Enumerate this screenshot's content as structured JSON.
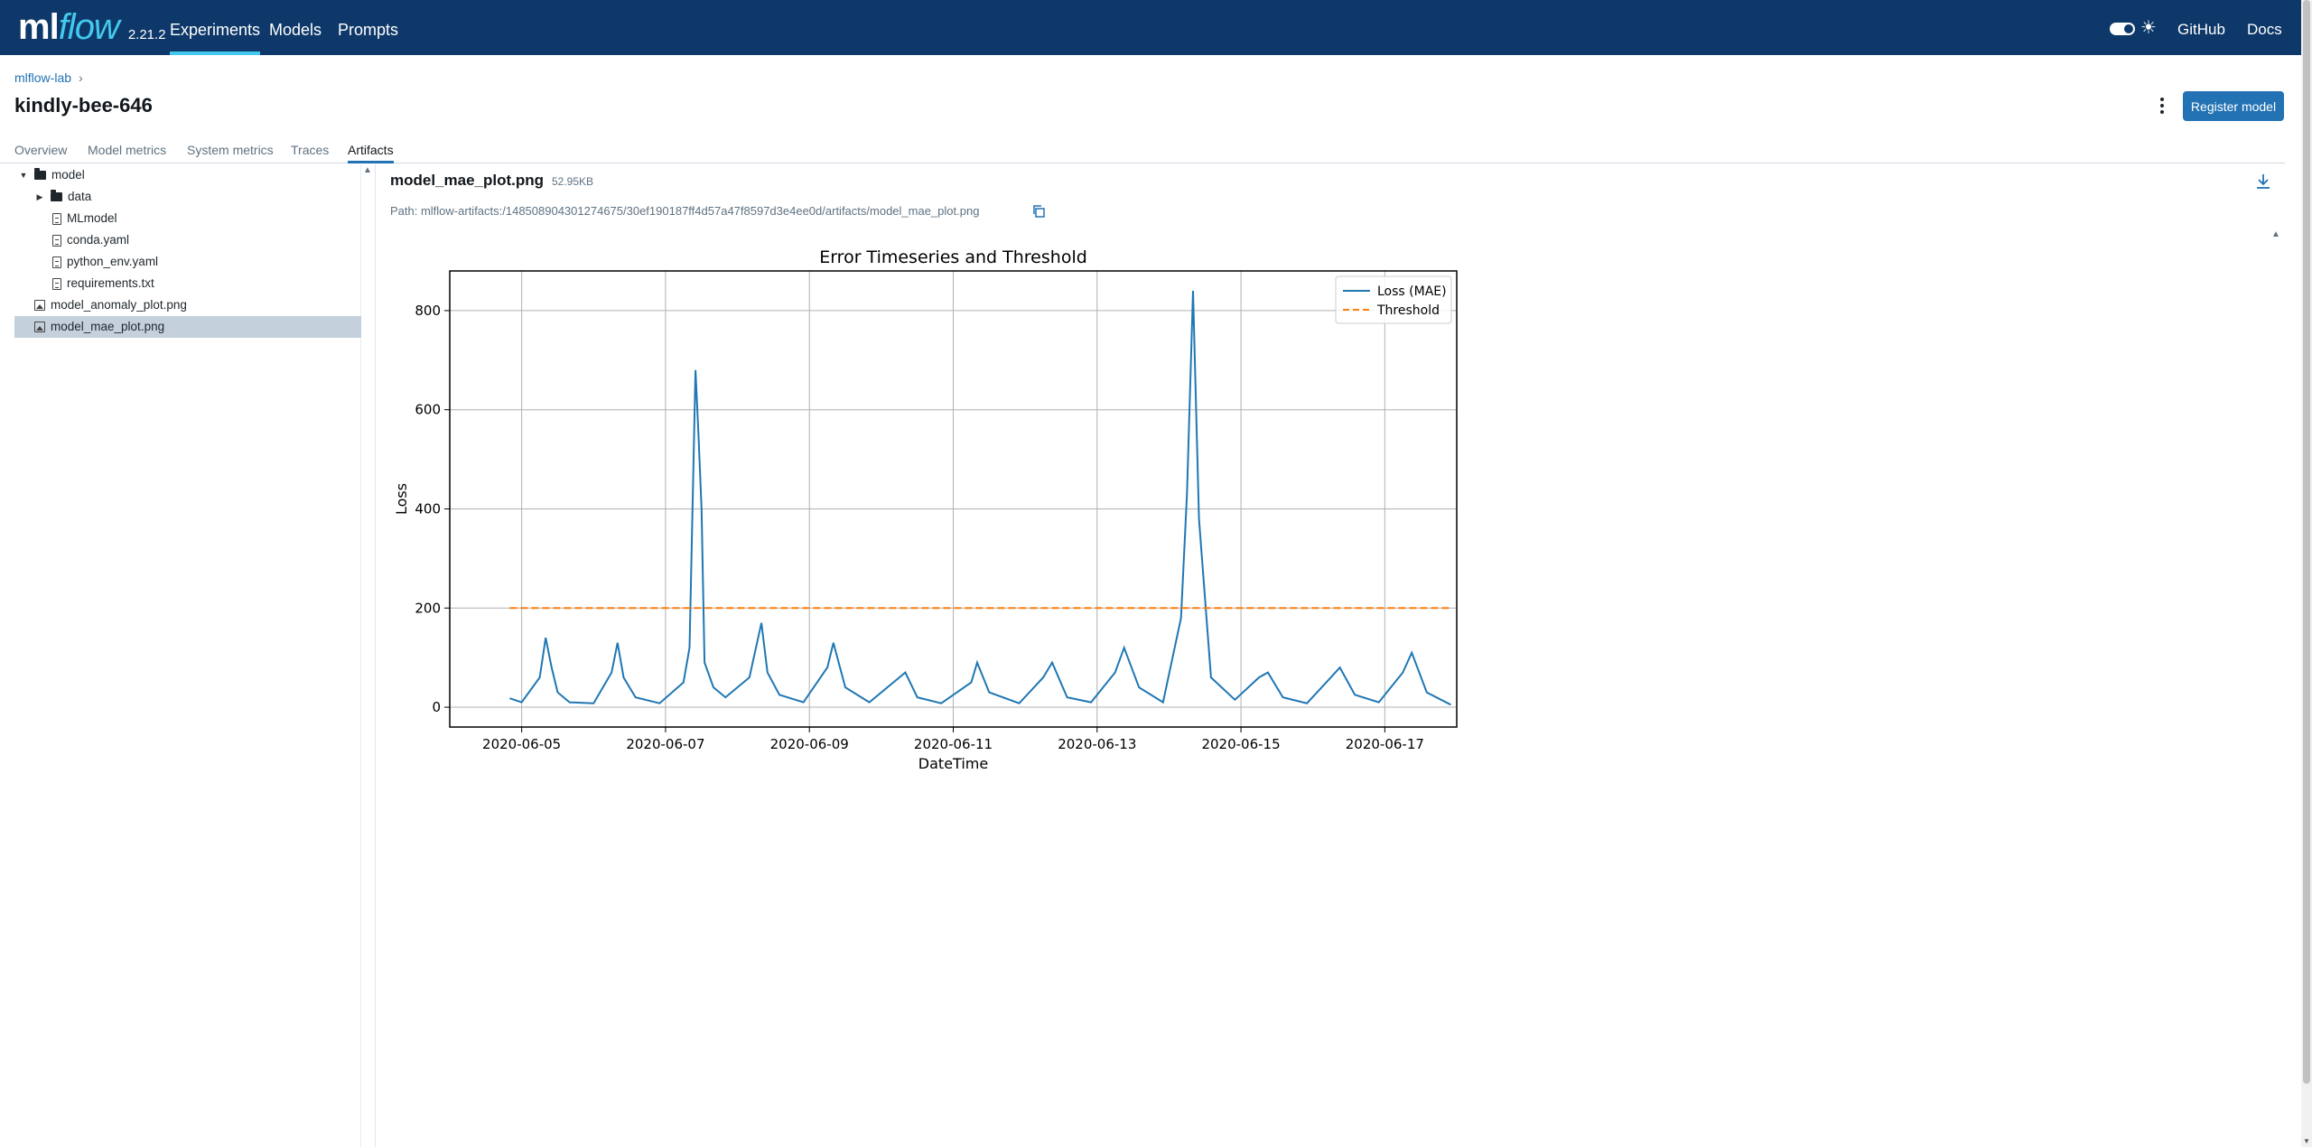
{
  "nav": {
    "logo_ml": "ml",
    "logo_flow": "flow",
    "version": "2.21.2",
    "links": [
      "Experiments",
      "Models",
      "Prompts"
    ],
    "github": "GitHub",
    "docs": "Docs",
    "accent_color": "#43c9ed",
    "bg_color": "#0e3869"
  },
  "header": {
    "breadcrumb": "mlflow-lab",
    "title": "kindly-bee-646",
    "register_button": "Register model"
  },
  "tabs": [
    "Overview",
    "Model metrics",
    "System metrics",
    "Traces",
    "Artifacts"
  ],
  "active_tab": "Artifacts",
  "tree": [
    {
      "label": "model",
      "type": "folder",
      "expanded": true
    },
    {
      "label": "data",
      "type": "folder",
      "expanded": false
    },
    {
      "label": "MLmodel",
      "type": "file"
    },
    {
      "label": "conda.yaml",
      "type": "file"
    },
    {
      "label": "python_env.yaml",
      "type": "file"
    },
    {
      "label": "requirements.txt",
      "type": "file"
    },
    {
      "label": "model_anomaly_plot.png",
      "type": "image"
    },
    {
      "label": "model_mae_plot.png",
      "type": "image",
      "selected": true
    }
  ],
  "artifact": {
    "name": "model_mae_plot.png",
    "size": "52.95KB",
    "path": "Path: mlflow-artifacts:/148508904301274675/30ef190187ff4d57a47f8597d3e4ee0d/artifacts/model_mae_plot.png"
  },
  "chart_data": {
    "type": "line",
    "title": "Error Timeseries and Threshold",
    "xlabel": "DateTime",
    "ylabel": "Loss",
    "xticks": [
      "2020-06-05",
      "2020-06-07",
      "2020-06-09",
      "2020-06-11",
      "2020-06-13",
      "2020-06-15",
      "2020-06-17"
    ],
    "yticks": [
      0,
      200,
      400,
      600,
      800
    ],
    "xlim": [
      "2020-06-04",
      "2020-06-18"
    ],
    "ylim": [
      -40,
      880
    ],
    "grid": true,
    "legend_position": "top-right",
    "series": [
      {
        "name": "Loss (MAE)",
        "color": "#1f77b4",
        "style": "solid",
        "x": [
          "2020-06-04T20:00",
          "2020-06-05T00:00",
          "2020-06-05T06:00",
          "2020-06-05T08:00",
          "2020-06-05T10:00",
          "2020-06-05T12:00",
          "2020-06-05T16:00",
          "2020-06-06T00:00",
          "2020-06-06T06:00",
          "2020-06-06T08:00",
          "2020-06-06T10:00",
          "2020-06-06T14:00",
          "2020-06-06T22:00",
          "2020-06-07T06:00",
          "2020-06-07T08:00",
          "2020-06-07T10:00",
          "2020-06-07T11:00",
          "2020-06-07T12:00",
          "2020-06-07T13:00",
          "2020-06-07T16:00",
          "2020-06-07T20:00",
          "2020-06-08T04:00",
          "2020-06-08T08:00",
          "2020-06-08T10:00",
          "2020-06-08T14:00",
          "2020-06-08T22:00",
          "2020-06-09T06:00",
          "2020-06-09T08:00",
          "2020-06-09T12:00",
          "2020-06-09T20:00",
          "2020-06-10T06:00",
          "2020-06-10T08:00",
          "2020-06-10T12:00",
          "2020-06-10T20:00",
          "2020-06-11T06:00",
          "2020-06-11T08:00",
          "2020-06-11T12:00",
          "2020-06-11T22:00",
          "2020-06-12T06:00",
          "2020-06-12T09:00",
          "2020-06-12T14:00",
          "2020-06-12T22:00",
          "2020-06-13T06:00",
          "2020-06-13T09:00",
          "2020-06-13T14:00",
          "2020-06-13T22:00",
          "2020-06-14T04:00",
          "2020-06-14T06:00",
          "2020-06-14T08:00",
          "2020-06-14T10:00",
          "2020-06-14T14:00",
          "2020-06-14T22:00",
          "2020-06-15T06:00",
          "2020-06-15T09:00",
          "2020-06-15T14:00",
          "2020-06-15T22:00",
          "2020-06-16T06:00",
          "2020-06-16T09:00",
          "2020-06-16T14:00",
          "2020-06-16T22:00",
          "2020-06-17T06:00",
          "2020-06-17T09:00",
          "2020-06-17T14:00",
          "2020-06-17T22:00"
        ],
        "values": [
          18,
          10,
          60,
          140,
          80,
          30,
          10,
          8,
          70,
          130,
          60,
          20,
          8,
          50,
          120,
          680,
          550,
          400,
          90,
          40,
          20,
          60,
          170,
          70,
          25,
          10,
          80,
          130,
          40,
          10,
          60,
          70,
          20,
          8,
          50,
          90,
          30,
          8,
          60,
          90,
          20,
          10,
          70,
          120,
          40,
          10,
          180,
          430,
          840,
          380,
          60,
          15,
          60,
          70,
          20,
          8,
          60,
          80,
          25,
          10,
          70,
          110,
          30,
          5
        ]
      },
      {
        "name": "Threshold",
        "color": "#ff7f0e",
        "style": "dashed",
        "x": [
          "2020-06-04T20:00",
          "2020-06-17T22:00"
        ],
        "values": [
          200,
          200
        ]
      }
    ]
  }
}
